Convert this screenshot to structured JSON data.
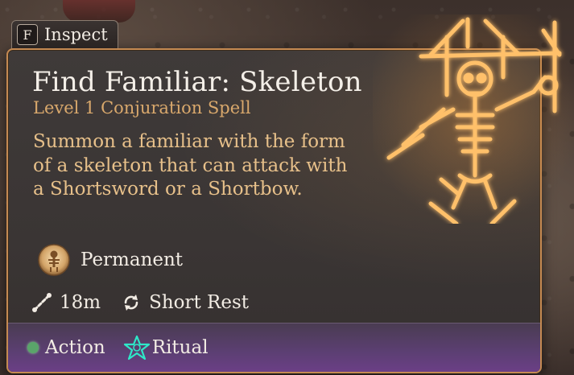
{
  "inspect": {
    "key": "F",
    "label": "Inspect"
  },
  "spell": {
    "title": "Find Familiar: Skeleton",
    "subtitle": "Level 1 Conjuration Spell",
    "description": "Summon a familiar with the form of a skeleton that can attack with a Shortsword or a Shortbow.",
    "duration": "Permanent",
    "range": "18m",
    "recharge": "Short Rest",
    "cost": "Action",
    "tag": "Ritual"
  },
  "icons": {
    "duration": "skeleton-medallion-icon",
    "range": "range-icon",
    "recharge": "recharge-icon",
    "action": "action-dot-icon",
    "ritual": "ritual-pentagram-icon",
    "art": "skeleton-glyph-icon"
  },
  "colors": {
    "border": "#c58a52",
    "title": "#f4efe8",
    "subtitle": "#d9a86c",
    "description": "#e7c08a",
    "action_dot": "#5aa56a",
    "ritual": "#2ee8c8",
    "footer": "#5c3f73",
    "glow": "#ffb347"
  }
}
